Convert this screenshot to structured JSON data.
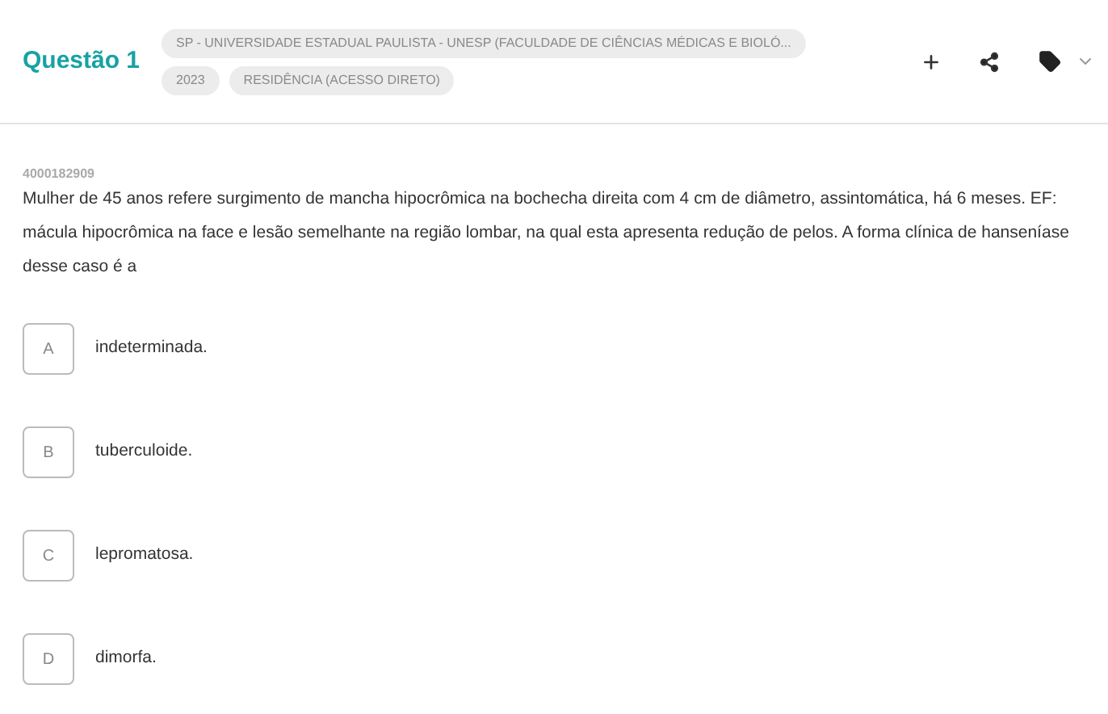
{
  "header": {
    "title": "Questão 1",
    "tags": [
      [
        "SP - UNIVERSIDADE ESTADUAL PAULISTA - UNESP (FACULDADE DE CIÊNCIAS MÉDICAS E BIOLÓ..."
      ],
      [
        "2023",
        "RESIDÊNCIA (ACESSO DIRETO)"
      ]
    ]
  },
  "question": {
    "id": "4000182909",
    "text": "Mulher de 45 anos refere surgimento de mancha hipocrômica na bochecha direita com 4 cm de diâmetro, assintomática, há 6 meses. EF: mácula hipocrômica na face e lesão semelhante na região lombar, na qual esta apresenta redução de pelos. A forma clínica de hanseníase desse caso é a"
  },
  "options": [
    {
      "letter": "A",
      "text": "indeterminada."
    },
    {
      "letter": "B",
      "text": "tuberculoide."
    },
    {
      "letter": "C",
      "text": "lepromatosa."
    },
    {
      "letter": "D",
      "text": "dimorfa."
    }
  ]
}
